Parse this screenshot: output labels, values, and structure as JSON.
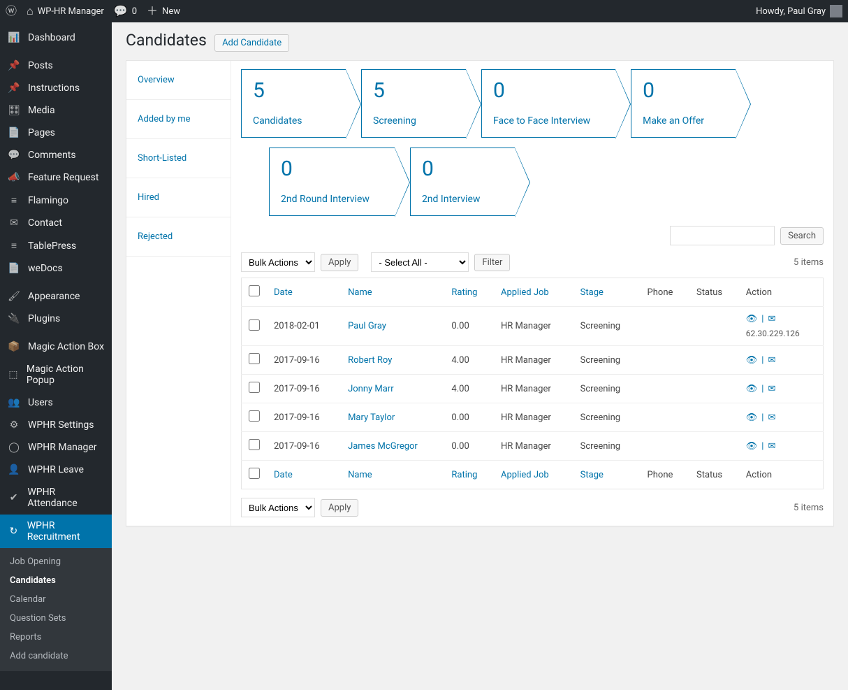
{
  "adminbar": {
    "site_name": "WP-HR Manager",
    "comments": "0",
    "new": "New",
    "greeting": "Howdy, Paul Gray"
  },
  "sidebar": {
    "items": [
      {
        "icon": "📊",
        "label": "Dashboard"
      },
      {
        "icon": "📌",
        "label": "Posts"
      },
      {
        "icon": "📌",
        "label": "Instructions"
      },
      {
        "icon": "🎛",
        "label": "Media"
      },
      {
        "icon": "📄",
        "label": "Pages"
      },
      {
        "icon": "💬",
        "label": "Comments"
      },
      {
        "icon": "📣",
        "label": "Feature Request"
      },
      {
        "icon": "≡",
        "label": "Flamingo"
      },
      {
        "icon": "✉",
        "label": "Contact"
      },
      {
        "icon": "≡",
        "label": "TablePress"
      },
      {
        "icon": "📄",
        "label": "weDocs"
      },
      {
        "icon": "🖌",
        "label": "Appearance"
      },
      {
        "icon": "🔌",
        "label": "Plugins"
      },
      {
        "icon": "📦",
        "label": "Magic Action Box",
        "red": true
      },
      {
        "icon": "⬚",
        "label": "Magic Action Popup"
      },
      {
        "icon": "👥",
        "label": "Users"
      },
      {
        "icon": "⚙",
        "label": "WPHR Settings"
      },
      {
        "icon": "◯",
        "label": "WPHR Manager"
      },
      {
        "icon": "👤",
        "label": "WPHR Leave"
      },
      {
        "icon": "✔",
        "label": "WPHR Attendance"
      },
      {
        "icon": "↻",
        "label": "WPHR Recruitment",
        "current": true
      }
    ],
    "submenu": [
      {
        "label": "Job Opening"
      },
      {
        "label": "Candidates",
        "current": true
      },
      {
        "label": "Calendar"
      },
      {
        "label": "Question Sets"
      },
      {
        "label": "Reports"
      },
      {
        "label": "Add candidate"
      }
    ]
  },
  "page": {
    "title": "Candidates",
    "add_btn": "Add Candidate",
    "search_btn": "Search",
    "bulk_label": "Bulk Actions",
    "apply_label": "Apply",
    "select_all_label": "- Select All -",
    "filter_label": "Filter",
    "items_count": "5 items"
  },
  "vtabs": [
    "Overview",
    "Added by me",
    "Short-Listed",
    "Hired",
    "Rejected"
  ],
  "stages_row1": [
    {
      "count": "5",
      "label": "Candidates"
    },
    {
      "count": "5",
      "label": "Screening"
    },
    {
      "count": "0",
      "label": "Face to Face Interview"
    },
    {
      "count": "0",
      "label": "Make an Offer"
    }
  ],
  "stages_row2": [
    {
      "count": "0",
      "label": "2nd Round Interview"
    },
    {
      "count": "0",
      "label": "2nd Interview"
    }
  ],
  "table": {
    "headers": [
      "Date",
      "Name",
      "Rating",
      "Applied Job",
      "Stage",
      "Phone",
      "Status",
      "Action"
    ],
    "rows": [
      {
        "date": "2018-02-01",
        "name": "Paul Gray",
        "rating": "0.00",
        "job": "HR Manager",
        "stage": "Screening",
        "phone": "",
        "status": "",
        "ip": "62.30.229.126"
      },
      {
        "date": "2017-09-16",
        "name": "Robert Roy",
        "rating": "4.00",
        "job": "HR Manager",
        "stage": "Screening",
        "phone": "",
        "status": "",
        "ip": ""
      },
      {
        "date": "2017-09-16",
        "name": "Jonny Marr",
        "rating": "4.00",
        "job": "HR Manager",
        "stage": "Screening",
        "phone": "",
        "status": "",
        "ip": ""
      },
      {
        "date": "2017-09-16",
        "name": "Mary Taylor",
        "rating": "0.00",
        "job": "HR Manager",
        "stage": "Screening",
        "phone": "",
        "status": "",
        "ip": ""
      },
      {
        "date": "2017-09-16",
        "name": "James McGregor",
        "rating": "0.00",
        "job": "HR Manager",
        "stage": "Screening",
        "phone": "",
        "status": "",
        "ip": ""
      }
    ]
  }
}
